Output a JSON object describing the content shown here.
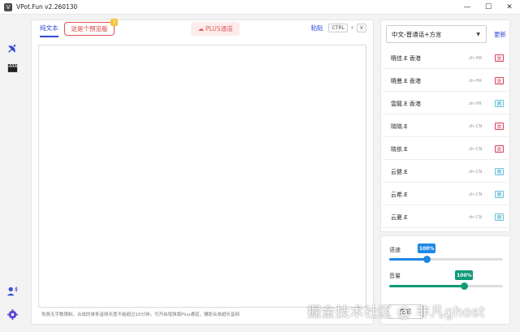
{
  "window": {
    "title": "VPot.Fun v2.260130",
    "controls": [
      "—",
      "☐",
      "✕"
    ]
  },
  "rail": {
    "icons": [
      "satellite-dish-icon",
      "clapperboard-icon",
      "voice-user-icon",
      "settings-icon"
    ]
  },
  "tabs": {
    "plain": "纯文本",
    "preview": "这是个预览版",
    "preview_badge": "!",
    "plus": "PLUS通道"
  },
  "paste": {
    "label": "粘贴",
    "key1": "CTRL",
    "plus": "+",
    "key2": "V"
  },
  "editor": {
    "value": "",
    "note": "免费无字数限制，合成的单条音频长度不能超过10分钟。可开启增强版Plus通道，辅助合成超长音频"
  },
  "voice_panel": {
    "select_value": "中文-普通话+方言",
    "refresh": "更新",
    "voices": [
      {
        "name": "曉佳.E 香港",
        "locale": "zh-HK",
        "gender": "女",
        "g": "f"
      },
      {
        "name": "曉曼.E 香港",
        "locale": "zh-HK",
        "gender": "女",
        "g": "f"
      },
      {
        "name": "雲龍.E 香港",
        "locale": "zh-HK",
        "gender": "男",
        "g": "m"
      },
      {
        "name": "晓晓.E",
        "locale": "zh-CN",
        "gender": "女",
        "g": "f"
      },
      {
        "name": "晓依.E",
        "locale": "zh-CN",
        "gender": "女",
        "g": "f"
      },
      {
        "name": "云健.E",
        "locale": "zh-CN",
        "gender": "男",
        "g": "m"
      },
      {
        "name": "云希.E",
        "locale": "zh-CN",
        "gender": "男",
        "g": "m"
      },
      {
        "name": "云夏.E",
        "locale": "zh-CN",
        "gender": "男",
        "g": "m"
      }
    ]
  },
  "sliders": {
    "speed": {
      "label": "语速",
      "value": "100%",
      "level": 0.33,
      "color": "#1e88e5"
    },
    "volume": {
      "label": "音量",
      "value": "100%",
      "level": 0.66,
      "color": "#109a7a"
    }
  },
  "bottom": {
    "btn1": "生成",
    "btn2": ""
  },
  "watermark": "掘金技术社区 @ 非凡ghost"
}
